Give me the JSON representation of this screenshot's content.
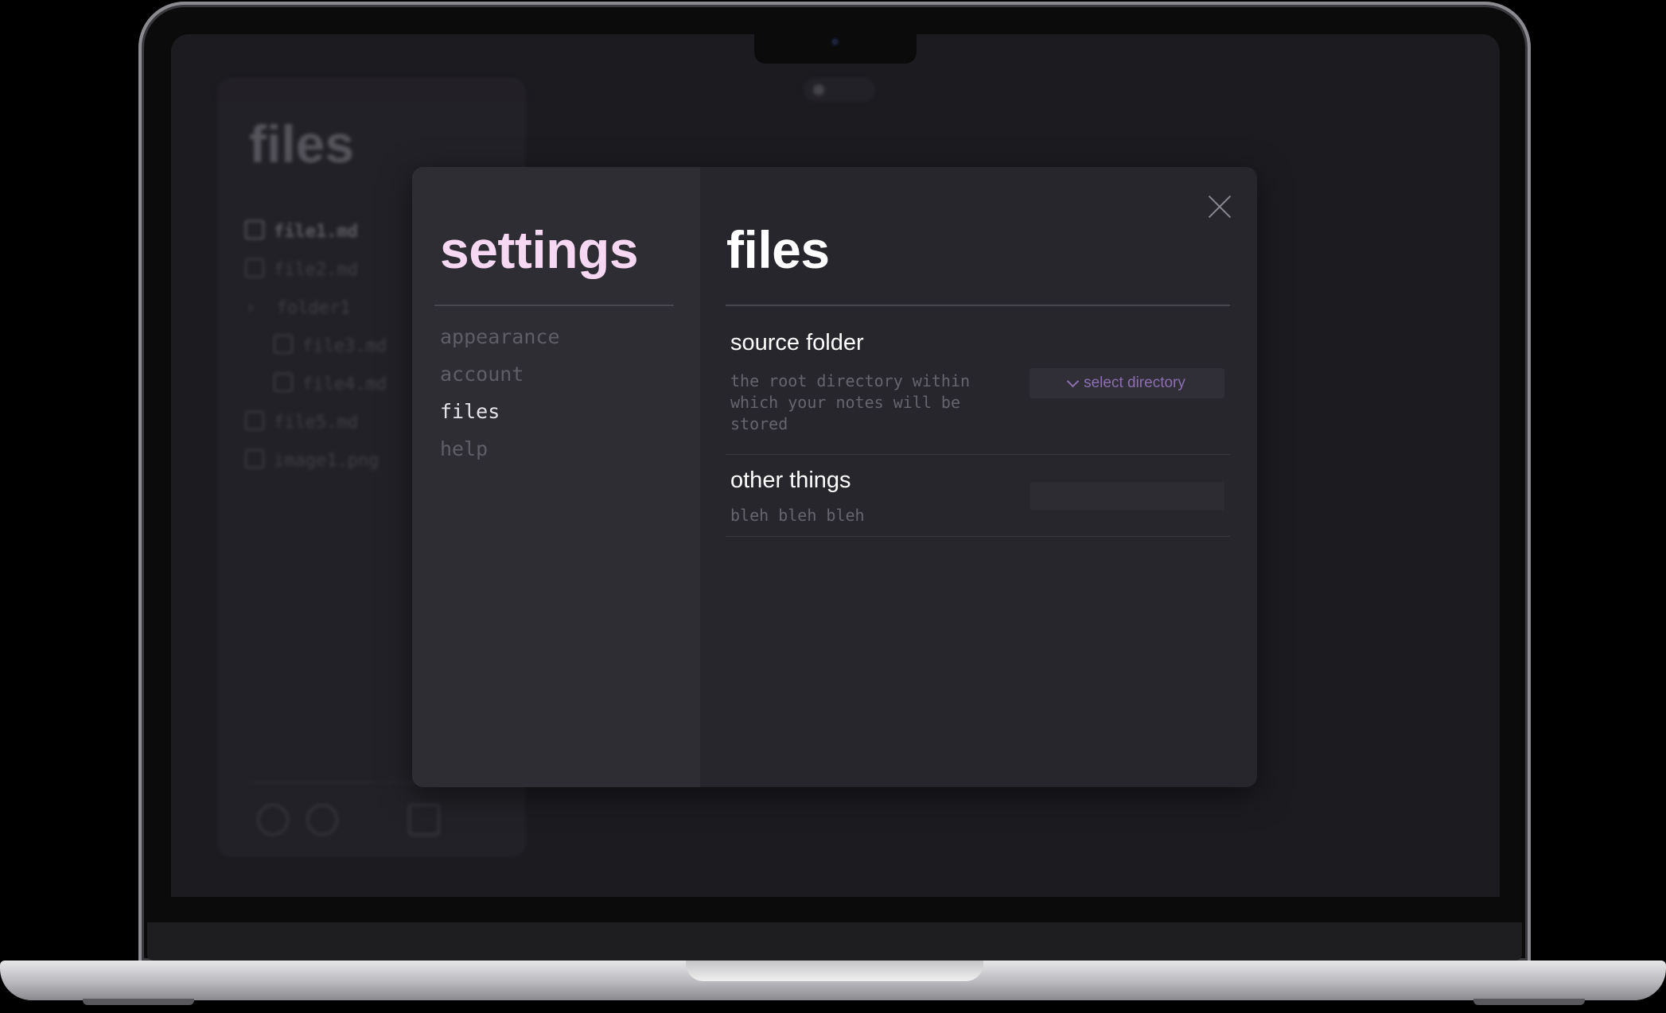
{
  "background_app": {
    "title": "files",
    "files": [
      {
        "name": "file1.md",
        "type": "file"
      },
      {
        "name": "file2.md",
        "type": "file"
      },
      {
        "name": "folder1",
        "type": "folder"
      },
      {
        "name": "file3.md",
        "type": "file",
        "nested": true
      },
      {
        "name": "file4.md",
        "type": "file",
        "nested": true
      },
      {
        "name": "file5.md",
        "type": "file"
      },
      {
        "name": "image1.png",
        "type": "image"
      }
    ]
  },
  "settings": {
    "title": "settings",
    "nav": [
      {
        "label": "appearance",
        "active": false
      },
      {
        "label": "account",
        "active": false
      },
      {
        "label": "files",
        "active": true
      },
      {
        "label": "help",
        "active": false
      }
    ]
  },
  "content": {
    "title": "files",
    "rows": [
      {
        "name": "source folder",
        "description": "the root directory within which your notes will be stored",
        "control_label": "select directory",
        "control_icon": "chevron-down-icon"
      },
      {
        "name": "other things",
        "description": "bleh bleh bleh"
      }
    ]
  },
  "colors": {
    "accent": "#8b6fb0",
    "settings_title": "#f6d8f3",
    "modal_bg": "#27262d",
    "nav_bg": "#2e2d34"
  }
}
